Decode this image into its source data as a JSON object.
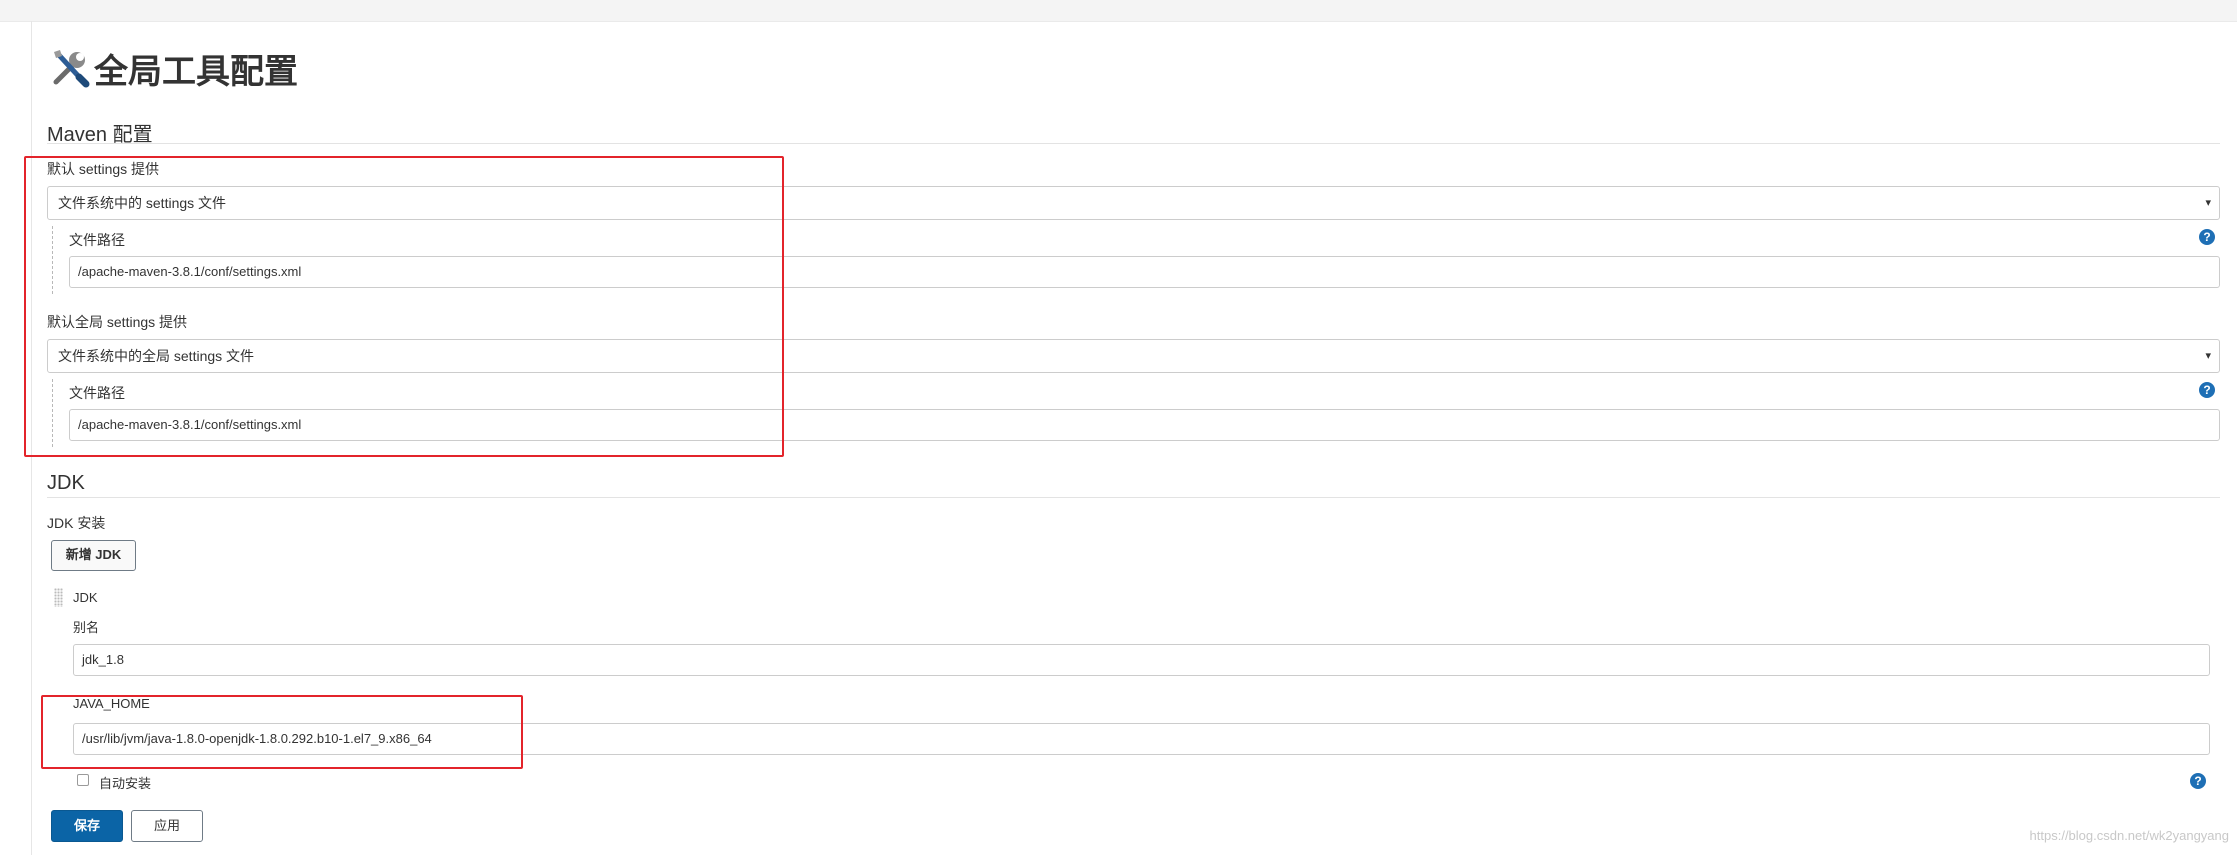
{
  "page": {
    "title": "全局工具配置",
    "title_icon": "tools-icon"
  },
  "maven": {
    "heading": "Maven 配置",
    "settings_label": "默认 settings 提供",
    "settings_select": "文件系统中的 settings 文件",
    "file_path_label": "文件路径",
    "file_path_value": "/apache-maven-3.8.1/conf/settings.xml",
    "global_settings_label": "默认全局 settings 提供",
    "global_settings_select": "文件系统中的全局 settings 文件",
    "global_file_path_label": "文件路径",
    "global_file_path_value": "/apache-maven-3.8.1/conf/settings.xml"
  },
  "jdk": {
    "heading": "JDK",
    "installations_label": "JDK 安装",
    "add_button": "新增 JDK",
    "item_title": "JDK",
    "alias_label": "别名",
    "alias_value": "jdk_1.8",
    "java_home_label": "JAVA_HOME",
    "java_home_value": "/usr/lib/jvm/java-1.8.0-openjdk-1.8.0.292.b10-1.el7_9.x86_64",
    "auto_install_label": "自动安装",
    "auto_install_checked": false
  },
  "actions": {
    "save": "保存",
    "apply": "应用"
  },
  "help": {
    "glyph": "?"
  },
  "select_arrow": "▾",
  "watermark": "https://blog.csdn.net/wk2yangyang",
  "colors": {
    "primary": "#0b64a6",
    "highlight": "#e3242b",
    "help": "#1e6fb5"
  }
}
